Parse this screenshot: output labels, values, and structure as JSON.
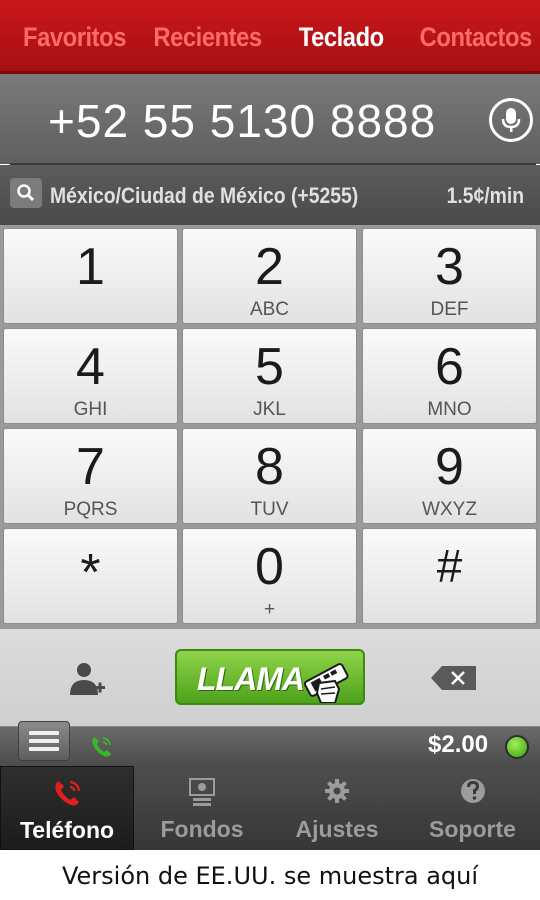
{
  "tabs": [
    "Favoritos",
    "Recientes",
    "Teclado",
    "Contactos"
  ],
  "display": {
    "number": "+52 55 5130 8888"
  },
  "location": {
    "name": "México/Ciudad de México (+5255)",
    "rate": "1.5¢/min"
  },
  "keys": [
    {
      "digit": "1",
      "letters": ""
    },
    {
      "digit": "2",
      "letters": "ABC"
    },
    {
      "digit": "3",
      "letters": "DEF"
    },
    {
      "digit": "4",
      "letters": "GHI"
    },
    {
      "digit": "5",
      "letters": "JKL"
    },
    {
      "digit": "6",
      "letters": "MNO"
    },
    {
      "digit": "7",
      "letters": "PQRS"
    },
    {
      "digit": "8",
      "letters": "TUV"
    },
    {
      "digit": "9",
      "letters": "WXYZ"
    },
    {
      "digit": "*",
      "letters": ""
    },
    {
      "digit": "0",
      "letters": "+"
    },
    {
      "digit": "#",
      "letters": ""
    }
  ],
  "call_label": "LLAMA",
  "balance": "$2.00",
  "nav": [
    "Teléfono",
    "Fondos",
    "Ajustes",
    "Soporte"
  ],
  "caption": "Versión de EE.UU. se muestra aquí",
  "colors": {
    "brand_red": "#c8171b",
    "call_green": "#5fb325",
    "online_green": "#6ad22a"
  }
}
